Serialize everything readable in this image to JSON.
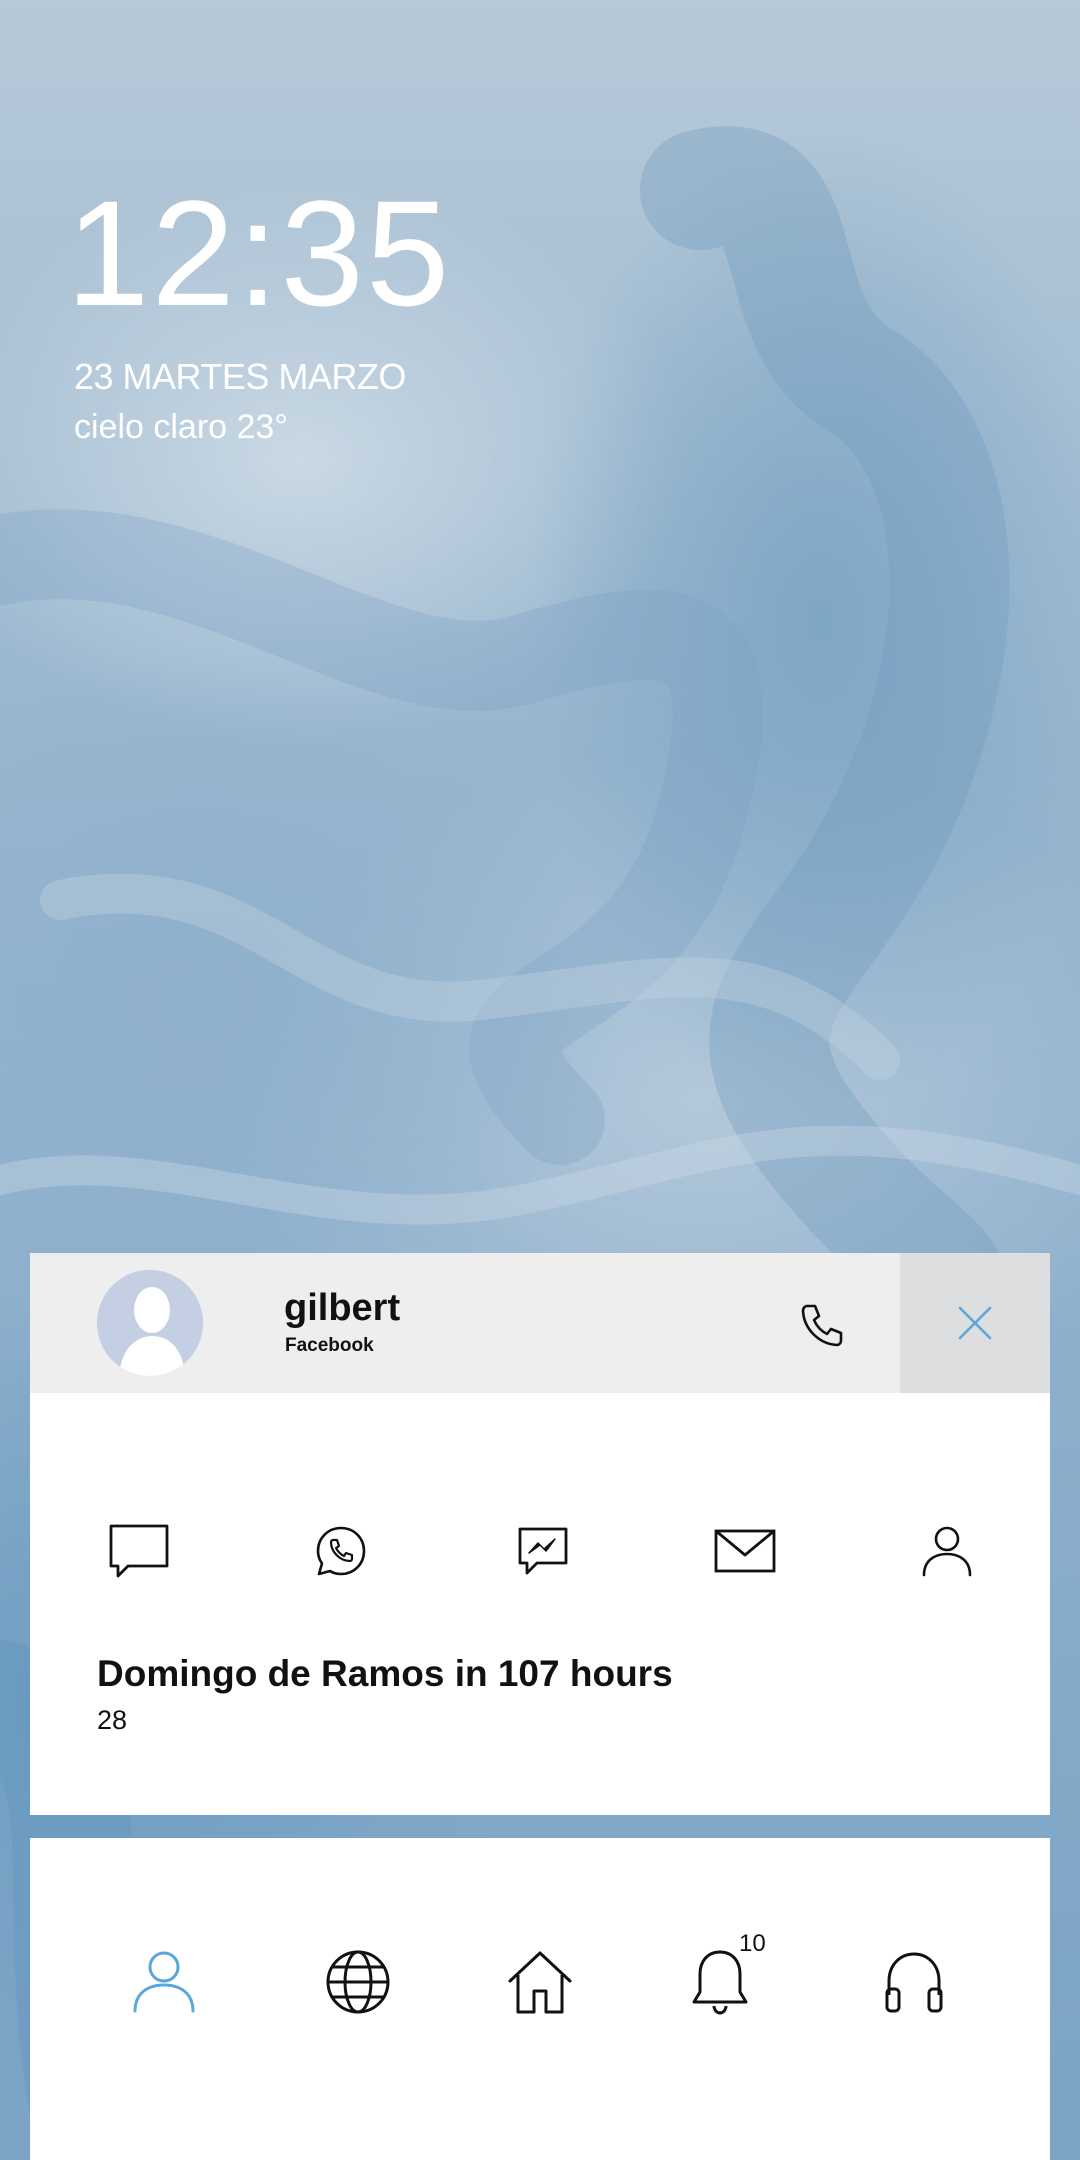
{
  "lockscreen": {
    "time": "12:35",
    "date": "23 MARTES MARZO",
    "weather": "cielo claro 23°"
  },
  "contact_card": {
    "name": "gilbert",
    "source": "Facebook",
    "avatar_icon": "person-silhouette-icon",
    "call_icon": "phone-icon",
    "close_icon": "close-icon",
    "actions": [
      {
        "name": "message-icon"
      },
      {
        "name": "whatsapp-icon"
      },
      {
        "name": "messenger-icon"
      },
      {
        "name": "mail-icon"
      },
      {
        "name": "contact-icon"
      }
    ],
    "event_title": "Domingo de Ramos in 107 hours",
    "event_subtitle": "28"
  },
  "dock": {
    "items": [
      {
        "name": "people-icon",
        "active": true
      },
      {
        "name": "globe-icon"
      },
      {
        "name": "home-icon"
      },
      {
        "name": "notifications-icon",
        "badge": "10"
      },
      {
        "name": "headphones-icon"
      }
    ],
    "active_color": "#5aa7d9"
  },
  "colors": {
    "card_header": "#eeeeee",
    "close_button_bg": "#dddee0",
    "close_icon": "#5aa7d9"
  }
}
